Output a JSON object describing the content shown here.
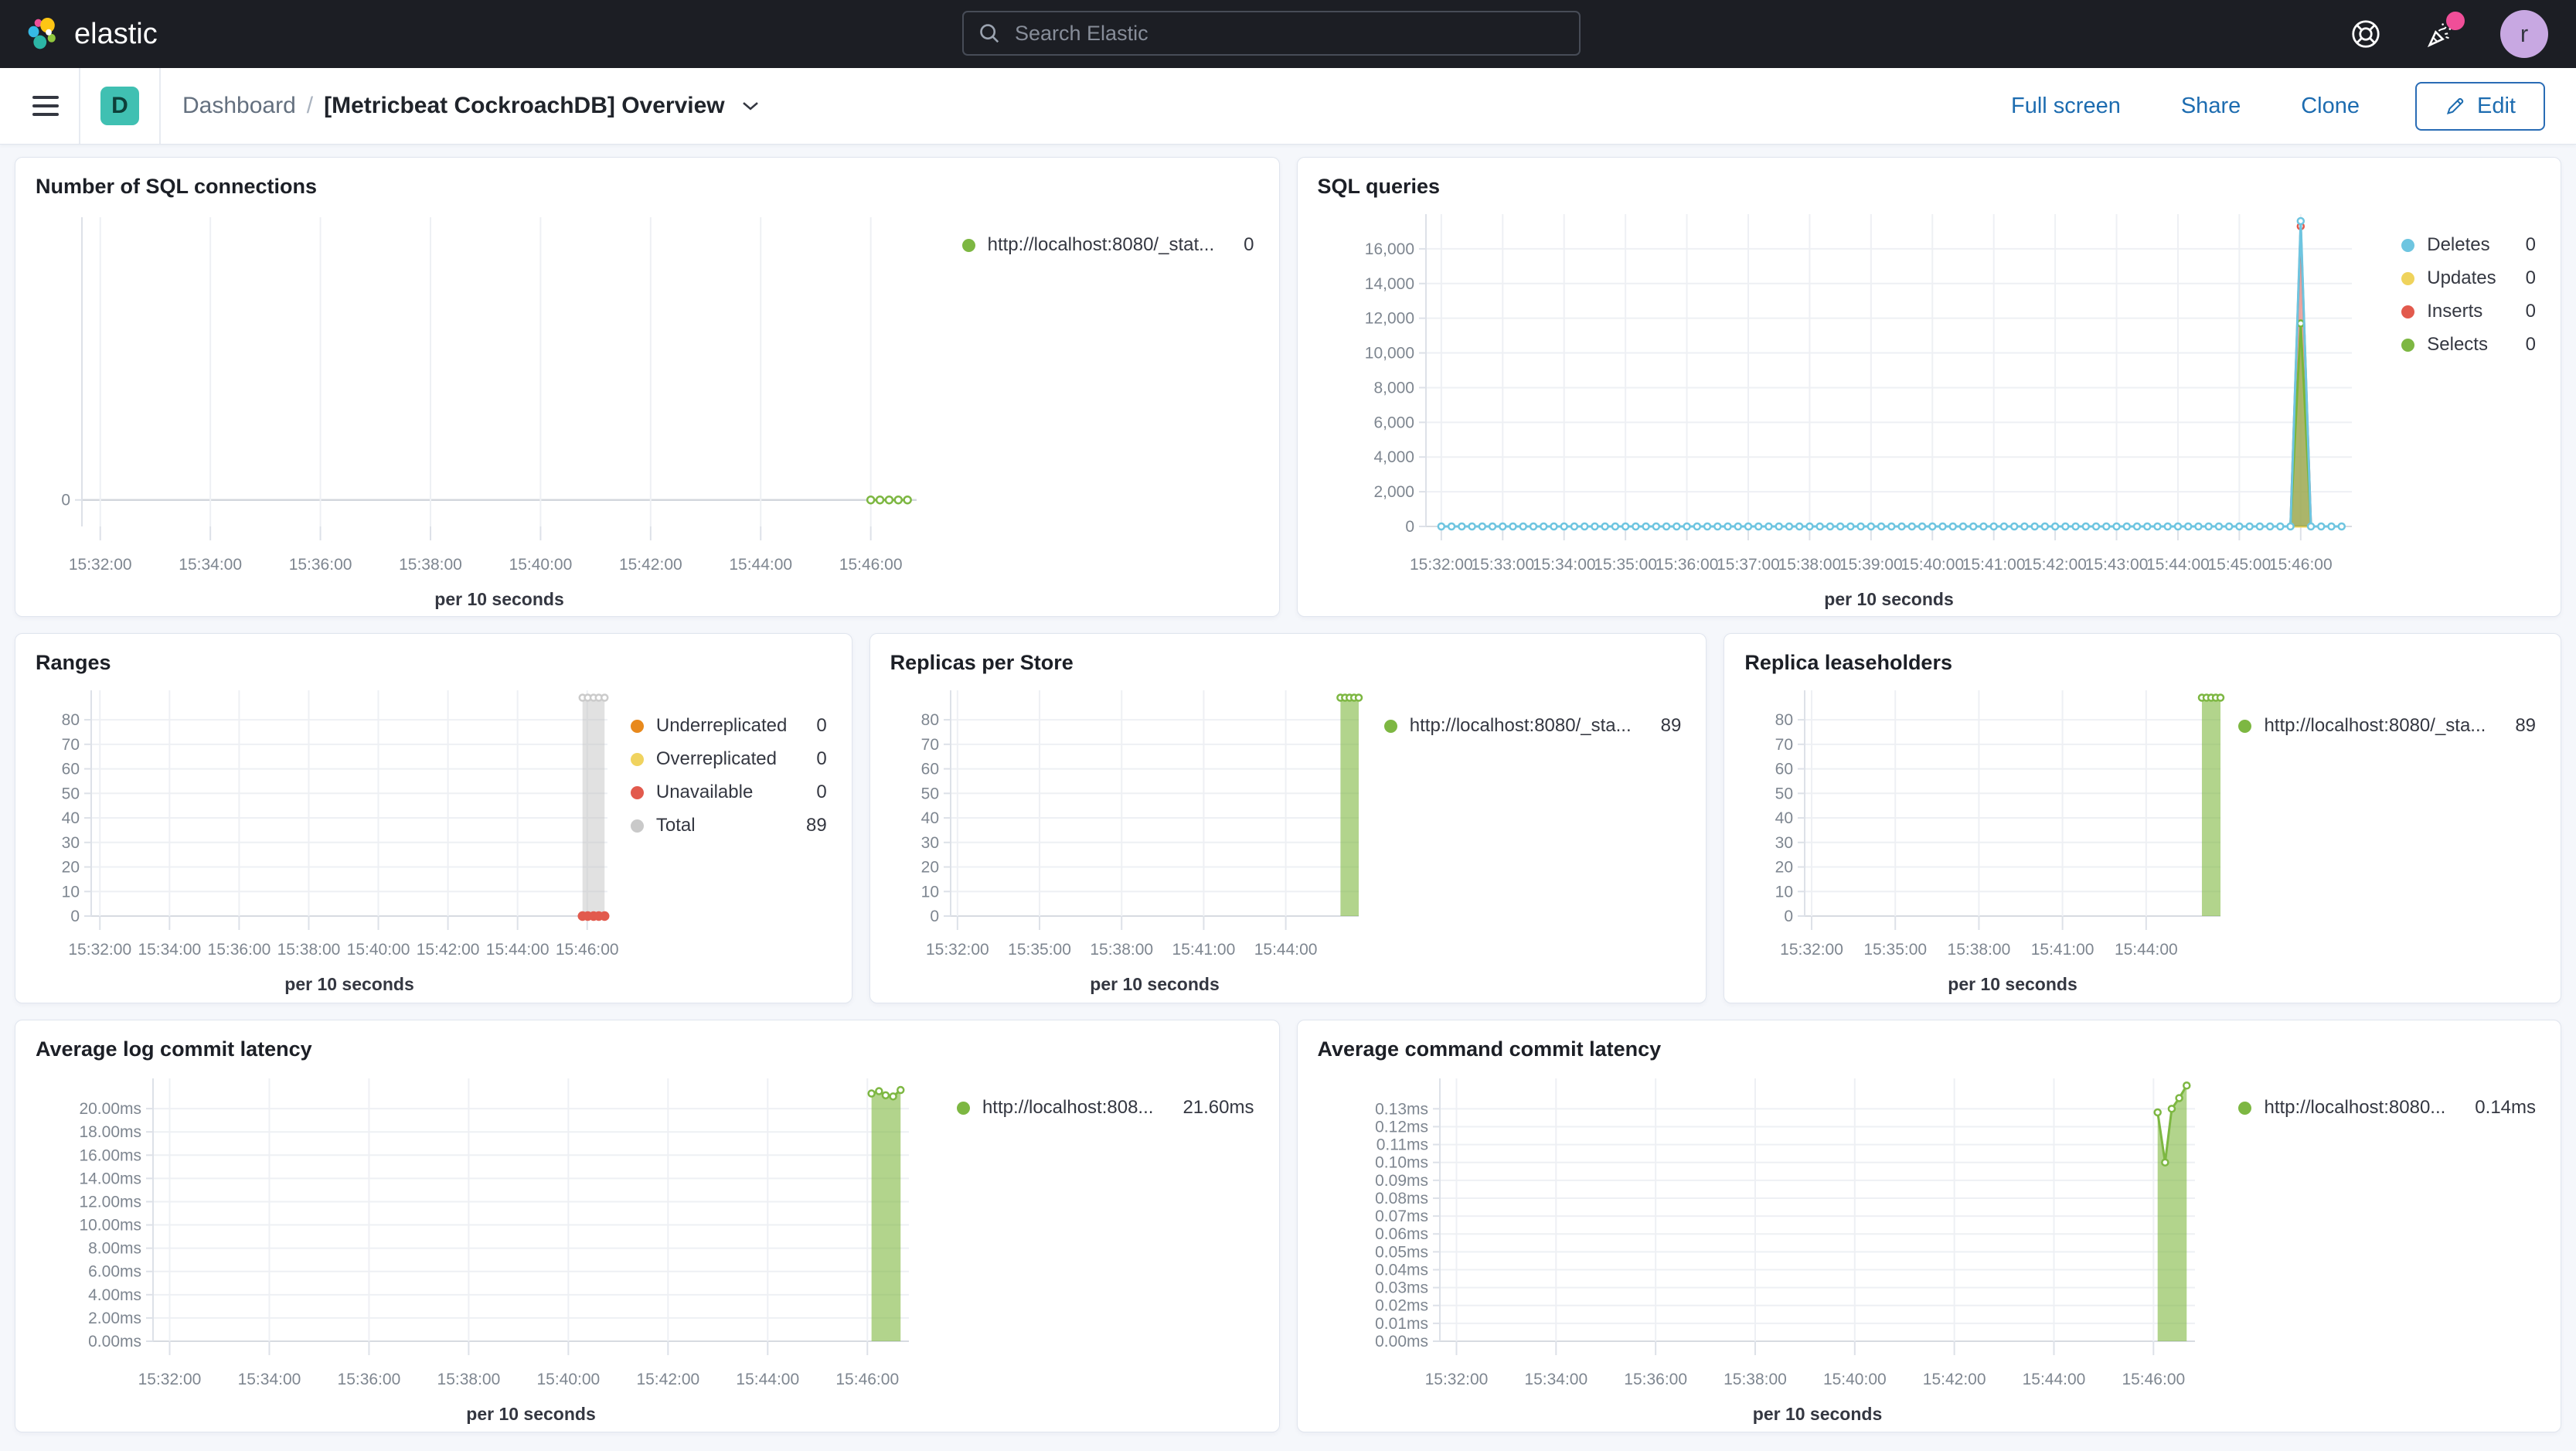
{
  "topbar": {
    "brand": "elastic",
    "search_placeholder": "Search Elastic",
    "avatar_initial": "r",
    "notification_color": "#f04e98",
    "avatar_color": "#c8a8e2"
  },
  "toolbar": {
    "dashboard_badge": "D",
    "badge_color": "#40c0b2",
    "breadcrumb_root": "Dashboard",
    "breadcrumb_sep": "/",
    "title": "[Metricbeat CockroachDB] Overview",
    "actions": {
      "full_screen": "Full screen",
      "share": "Share",
      "clone": "Clone",
      "edit": "Edit"
    },
    "link_color": "#1d6cb0"
  },
  "panels": [
    {
      "id": "p1",
      "title": "Number of SQL connections",
      "legend": [
        {
          "color": "#7db742",
          "label": "http://localhost:8080/_stat...",
          "value": "0"
        }
      ],
      "chart": {
        "type": "line",
        "x_label": "per 10 seconds",
        "x_domain": [
          "15:31:40",
          "15:46:50"
        ],
        "x_ticks": [
          "15:32:00",
          "15:34:00",
          "15:36:00",
          "15:38:00",
          "15:40:00",
          "15:42:00",
          "15:44:00",
          "15:46:00"
        ],
        "y_domain": [
          -1.5,
          16
        ],
        "h_grid": false,
        "y_ticks": [
          {
            "v": 0,
            "label": "0"
          }
        ],
        "series": [
          {
            "name": "http://localhost:8080/_stat...",
            "color": "#7db742",
            "width": 3,
            "markers": true,
            "r": 4.5,
            "gen": {
              "start": "15:46:00",
              "end": "15:46:40",
              "step": 10,
              "value": 0
            }
          }
        ]
      }
    },
    {
      "id": "p2",
      "title": "SQL queries",
      "legend": [
        {
          "color": "#6ec5e0",
          "label": "Deletes",
          "value": "0"
        },
        {
          "color": "#efd35c",
          "label": "Updates",
          "value": "0"
        },
        {
          "color": "#e25a4d",
          "label": "Inserts",
          "value": "0"
        },
        {
          "color": "#7db742",
          "label": "Selects",
          "value": "0"
        }
      ],
      "chart": {
        "type": "area",
        "x_label": "per 10 seconds",
        "x_domain": [
          "15:31:45",
          "15:46:50"
        ],
        "x_ticks": [
          "15:32:00",
          "15:33:00",
          "15:34:00",
          "15:35:00",
          "15:36:00",
          "15:37:00",
          "15:38:00",
          "15:39:00",
          "15:40:00",
          "15:41:00",
          "15:42:00",
          "15:43:00",
          "15:44:00",
          "15:45:00",
          "15:46:00"
        ],
        "y_domain": [
          0,
          18000
        ],
        "h_grid": true,
        "y_ticks": [
          {
            "v": 0,
            "label": "0"
          },
          {
            "v": 2000,
            "label": "2,000"
          },
          {
            "v": 4000,
            "label": "4,000"
          },
          {
            "v": 6000,
            "label": "6,000"
          },
          {
            "v": 8000,
            "label": "8,000"
          },
          {
            "v": 10000,
            "label": "10,000"
          },
          {
            "v": 12000,
            "label": "12,000"
          },
          {
            "v": 14000,
            "label": "14,000"
          },
          {
            "v": 16000,
            "label": "16,000"
          }
        ],
        "series": [
          {
            "name": "Updates",
            "color": "#efd35c",
            "width": 3,
            "markers": false,
            "gen": {
              "start": "15:32:00",
              "end": "15:46:40",
              "step": 10,
              "value": 0
            }
          },
          {
            "name": "Inserts",
            "color": "#e25a4d",
            "width": 3,
            "area": true,
            "fill": "rgba(226,90,77,0.5)",
            "points": [
              [
                "15:45:50",
                0
              ],
              [
                "15:46:00",
                17300
              ],
              [
                "15:46:10",
                0
              ]
            ],
            "marker_points": [
              "15:46:00"
            ],
            "r": 4
          },
          {
            "name": "Selects",
            "color": "#79b63a",
            "width": 3,
            "area": true,
            "fill": "rgba(134,186,74,0.65)",
            "points": [
              [
                "15:45:50",
                0
              ],
              [
                "15:46:00",
                11700
              ],
              [
                "15:46:10",
                0
              ]
            ],
            "marker_points": [
              "15:46:00"
            ],
            "r": 4
          },
          {
            "name": "Deletes",
            "color": "#6ec5e0",
            "width": 3,
            "markers": true,
            "r": 4,
            "gen": {
              "start": "15:32:00",
              "end": "15:46:40",
              "step": 10,
              "value": 0
            },
            "spike": {
              "x": "15:46:00",
              "v": 17600
            }
          }
        ]
      }
    },
    {
      "id": "p3",
      "title": "Ranges",
      "legend": [
        {
          "color": "#e8891c",
          "label": "Underreplicated",
          "value": "0"
        },
        {
          "color": "#f0d35f",
          "label": "Overreplicated",
          "value": "0"
        },
        {
          "color": "#e25a4d",
          "label": "Unavailable",
          "value": "0"
        },
        {
          "color": "#c9c9c9",
          "label": "Total",
          "value": "89"
        }
      ],
      "chart": {
        "type": "area",
        "x_label": "per 10 seconds",
        "x_domain": [
          "15:31:45",
          "15:46:35"
        ],
        "x_ticks": [
          "15:32:00",
          "15:34:00",
          "15:36:00",
          "15:38:00",
          "15:40:00",
          "15:42:00",
          "15:44:00",
          "15:46:00"
        ],
        "y_domain": [
          0,
          92
        ],
        "h_grid": true,
        "y_ticks": [
          {
            "v": 0,
            "label": "0"
          },
          {
            "v": 10,
            "label": "10"
          },
          {
            "v": 20,
            "label": "20"
          },
          {
            "v": 30,
            "label": "30"
          },
          {
            "v": 40,
            "label": "40"
          },
          {
            "v": 50,
            "label": "50"
          },
          {
            "v": 60,
            "label": "60"
          },
          {
            "v": 70,
            "label": "70"
          },
          {
            "v": 80,
            "label": "80"
          }
        ],
        "series": [
          {
            "name": "Total",
            "color": "#cbcbcb",
            "width": 2.5,
            "area": true,
            "fill": "rgba(189,189,189,0.45)",
            "markers": true,
            "r": 4,
            "points": [
              [
                "15:45:52",
                89
              ],
              [
                "15:46:01",
                89
              ],
              [
                "15:46:11",
                89
              ],
              [
                "15:46:20",
                89
              ],
              [
                "15:46:30",
                89
              ]
            ]
          },
          {
            "name": "Underreplicated",
            "color": "#e8891c",
            "width": 3,
            "markers": false,
            "points": [
              [
                "15:45:52",
                0
              ],
              [
                "15:46:30",
                0
              ]
            ]
          },
          {
            "name": "Overreplicated",
            "color": "#f0d35f",
            "width": 3,
            "markers": false,
            "points": [
              [
                "15:45:52",
                0
              ],
              [
                "15:46:30",
                0
              ]
            ]
          },
          {
            "name": "Unavailable",
            "color": "#e25a4d",
            "width": 3,
            "markers": true,
            "solid": true,
            "r": 5,
            "points": [
              [
                "15:45:52",
                0
              ],
              [
                "15:46:01",
                0
              ],
              [
                "15:46:11",
                0
              ],
              [
                "15:46:20",
                0
              ],
              [
                "15:46:30",
                0
              ]
            ]
          }
        ]
      }
    },
    {
      "id": "p4",
      "title": "Replicas per Store",
      "legend": [
        {
          "color": "#7db742",
          "label": "http://localhost:8080/_sta...",
          "value": "89"
        }
      ],
      "chart": {
        "type": "area",
        "x_label": "per 10 seconds",
        "x_domain": [
          "15:31:45",
          "15:46:40"
        ],
        "x_ticks": [
          "15:32:00",
          "15:35:00",
          "15:38:00",
          "15:41:00",
          "15:44:00"
        ],
        "y_domain": [
          0,
          92
        ],
        "h_grid": true,
        "y_ticks": [
          {
            "v": 0,
            "label": "0"
          },
          {
            "v": 10,
            "label": "10"
          },
          {
            "v": 20,
            "label": "20"
          },
          {
            "v": 30,
            "label": "30"
          },
          {
            "v": 40,
            "label": "40"
          },
          {
            "v": 50,
            "label": "50"
          },
          {
            "v": 60,
            "label": "60"
          },
          {
            "v": 70,
            "label": "70"
          },
          {
            "v": 80,
            "label": "80"
          }
        ],
        "series": [
          {
            "name": "http://localhost:8080/_sta...",
            "color": "#7db742",
            "width": 3,
            "area": true,
            "fill": "rgba(126,183,63,0.6)",
            "markers": true,
            "r": 4,
            "points": [
              [
                "15:46:00",
                89
              ],
              [
                "15:46:10",
                89
              ],
              [
                "15:46:20",
                89
              ],
              [
                "15:46:30",
                89
              ],
              [
                "15:46:40",
                89
              ]
            ]
          }
        ]
      }
    },
    {
      "id": "p5",
      "title": "Replica leaseholders",
      "legend": [
        {
          "color": "#7db742",
          "label": "http://localhost:8080/_sta...",
          "value": "89"
        }
      ],
      "chart": {
        "type": "area",
        "x_label": "per 10 seconds",
        "x_domain": [
          "15:31:45",
          "15:46:40"
        ],
        "x_ticks": [
          "15:32:00",
          "15:35:00",
          "15:38:00",
          "15:41:00",
          "15:44:00"
        ],
        "y_domain": [
          0,
          92
        ],
        "h_grid": true,
        "y_ticks": [
          {
            "v": 0,
            "label": "0"
          },
          {
            "v": 10,
            "label": "10"
          },
          {
            "v": 20,
            "label": "20"
          },
          {
            "v": 30,
            "label": "30"
          },
          {
            "v": 40,
            "label": "40"
          },
          {
            "v": 50,
            "label": "50"
          },
          {
            "v": 60,
            "label": "60"
          },
          {
            "v": 70,
            "label": "70"
          },
          {
            "v": 80,
            "label": "80"
          }
        ],
        "series": [
          {
            "name": "http://localhost:8080/_sta...",
            "color": "#7db742",
            "width": 3,
            "area": true,
            "fill": "rgba(126,183,63,0.6)",
            "markers": true,
            "r": 4,
            "points": [
              [
                "15:46:00",
                89
              ],
              [
                "15:46:10",
                89
              ],
              [
                "15:46:20",
                89
              ],
              [
                "15:46:30",
                89
              ],
              [
                "15:46:40",
                89
              ]
            ]
          }
        ]
      }
    },
    {
      "id": "p6",
      "title": "Average log commit latency",
      "legend": [
        {
          "color": "#7db742",
          "label": "http://localhost:808...",
          "value": "21.60ms"
        }
      ],
      "chart": {
        "type": "area",
        "x_label": "per 10 seconds",
        "x_domain": [
          "15:31:40",
          "15:46:50"
        ],
        "x_ticks": [
          "15:32:00",
          "15:34:00",
          "15:36:00",
          "15:38:00",
          "15:40:00",
          "15:42:00",
          "15:44:00",
          "15:46:00"
        ],
        "y_domain": [
          0,
          22.6
        ],
        "h_grid": true,
        "y_ticks": [
          {
            "v": 0,
            "label": "0.00ms"
          },
          {
            "v": 2,
            "label": "2.00ms"
          },
          {
            "v": 4,
            "label": "4.00ms"
          },
          {
            "v": 6,
            "label": "6.00ms"
          },
          {
            "v": 8,
            "label": "8.00ms"
          },
          {
            "v": 10,
            "label": "10.00ms"
          },
          {
            "v": 12,
            "label": "12.00ms"
          },
          {
            "v": 14,
            "label": "14.00ms"
          },
          {
            "v": 16,
            "label": "16.00ms"
          },
          {
            "v": 18,
            "label": "18.00ms"
          },
          {
            "v": 20,
            "label": "20.00ms"
          }
        ],
        "series": [
          {
            "name": "http://localhost:808...",
            "color": "#7db742",
            "width": 3,
            "area": true,
            "fill": "rgba(126,183,63,0.6)",
            "markers": true,
            "r": 4,
            "points": [
              [
                "15:46:05",
                21.3
              ],
              [
                "15:46:14",
                21.5
              ],
              [
                "15:46:22",
                21.15
              ],
              [
                "15:46:31",
                21.05
              ],
              [
                "15:46:40",
                21.6
              ]
            ]
          }
        ]
      }
    },
    {
      "id": "p7",
      "title": "Average command commit latency",
      "legend": [
        {
          "color": "#7db742",
          "label": "http://localhost:8080...",
          "value": "0.14ms"
        }
      ],
      "chart": {
        "type": "area",
        "x_label": "per 10 seconds",
        "x_domain": [
          "15:31:40",
          "15:46:50"
        ],
        "x_ticks": [
          "15:32:00",
          "15:34:00",
          "15:36:00",
          "15:38:00",
          "15:40:00",
          "15:42:00",
          "15:44:00",
          "15:46:00"
        ],
        "y_domain": [
          0,
          0.147
        ],
        "h_grid": true,
        "y_ticks": [
          {
            "v": 0,
            "label": "0.00ms"
          },
          {
            "v": 0.01,
            "label": "0.01ms"
          },
          {
            "v": 0.02,
            "label": "0.02ms"
          },
          {
            "v": 0.03,
            "label": "0.03ms"
          },
          {
            "v": 0.04,
            "label": "0.04ms"
          },
          {
            "v": 0.05,
            "label": "0.05ms"
          },
          {
            "v": 0.06,
            "label": "0.06ms"
          },
          {
            "v": 0.07,
            "label": "0.07ms"
          },
          {
            "v": 0.08,
            "label": "0.08ms"
          },
          {
            "v": 0.09,
            "label": "0.09ms"
          },
          {
            "v": 0.1,
            "label": "0.10ms"
          },
          {
            "v": 0.11,
            "label": "0.11ms"
          },
          {
            "v": 0.12,
            "label": "0.12ms"
          },
          {
            "v": 0.13,
            "label": "0.13ms"
          }
        ],
        "series": [
          {
            "name": "http://localhost:8080...",
            "color": "#7db742",
            "width": 3,
            "area": true,
            "fill": "rgba(126,183,63,0.6)",
            "markers": true,
            "r": 4,
            "points": [
              [
                "15:46:05",
                0.128
              ],
              [
                "15:46:14",
                0.1
              ],
              [
                "15:46:22",
                0.13
              ],
              [
                "15:46:31",
                0.136
              ],
              [
                "15:46:40",
                0.143
              ]
            ]
          }
        ]
      }
    }
  ]
}
